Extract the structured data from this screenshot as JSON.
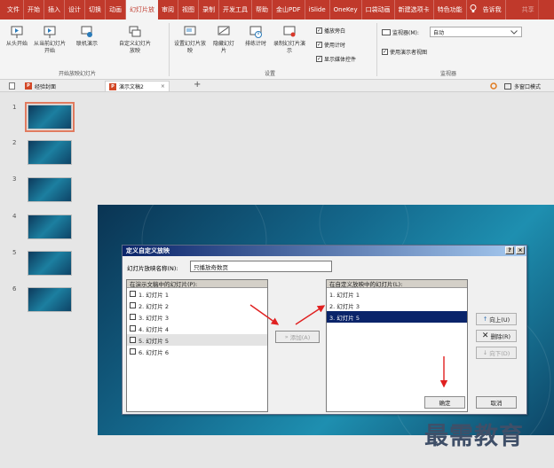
{
  "menubar": {
    "items": [
      "文件",
      "开始",
      "插入",
      "设计",
      "切换",
      "动画",
      "幻灯片放",
      "审阅",
      "视图",
      "录制",
      "开发工具",
      "帮助",
      "金山PDF",
      "iSlide",
      "OneKey",
      "口袋动画",
      "新建选项卡",
      "特色功能"
    ],
    "active_index": 6,
    "search_label": "告诉我",
    "share_label": "共享"
  },
  "ribbon": {
    "buttons": {
      "from_start": "从头开始",
      "from_current": "从当前幻灯片开始",
      "online": "联机演示",
      "custom": "自定义幻灯片放映",
      "setup": "设置幻灯片放映",
      "hide": "隐藏幻灯片",
      "rehearse": "排练计时",
      "record": "录制幻灯片演示"
    },
    "checks": {
      "narration": "播放旁白",
      "timing": "使用计时",
      "media": "显示媒体控件",
      "presenter": "使用演示者视图"
    },
    "monitor_label": "监视器(M):",
    "monitor_value": "自动",
    "groups": {
      "start": "开始放映幻灯片",
      "setup": "设置",
      "monitor": "监视器"
    }
  },
  "tabs": {
    "tab1": "经验封面",
    "tab2": "演示文稿2",
    "right_label": "多窗口模式"
  },
  "thumbnails": {
    "numbers": [
      "1",
      "2",
      "3",
      "4",
      "5",
      "6"
    ],
    "selected_index": 0
  },
  "dialog": {
    "title": "定义自定义放映",
    "help_btn": "?",
    "close_btn": "×",
    "name_label": "幻灯片放映名称(N):",
    "name_value": "只播放奇数页",
    "left_header": "在演示文稿中的幻灯片(P):",
    "left_items": [
      "1. 幻灯片 1",
      "2. 幻灯片 2",
      "3. 幻灯片 3",
      "4. 幻灯片 4",
      "5. 幻灯片 5",
      "6. 幻灯片 6"
    ],
    "left_highlight_index": 4,
    "right_header": "在自定义放映中的幻灯片(L):",
    "right_items": [
      "1. 幻灯片 1",
      "2. 幻灯片 3",
      "3. 幻灯片 5"
    ],
    "right_selected_index": 2,
    "add_btn": "添加(A)",
    "up_btn": "向上(U)",
    "delete_btn": "删除(R)",
    "down_btn": "向下(D)",
    "ok_btn": "确定",
    "cancel_btn": "取消"
  },
  "watermark": "最需教育",
  "colors": {
    "menubar": "#c0392b",
    "arrow": "#e02020",
    "selection": "#0a246a"
  }
}
